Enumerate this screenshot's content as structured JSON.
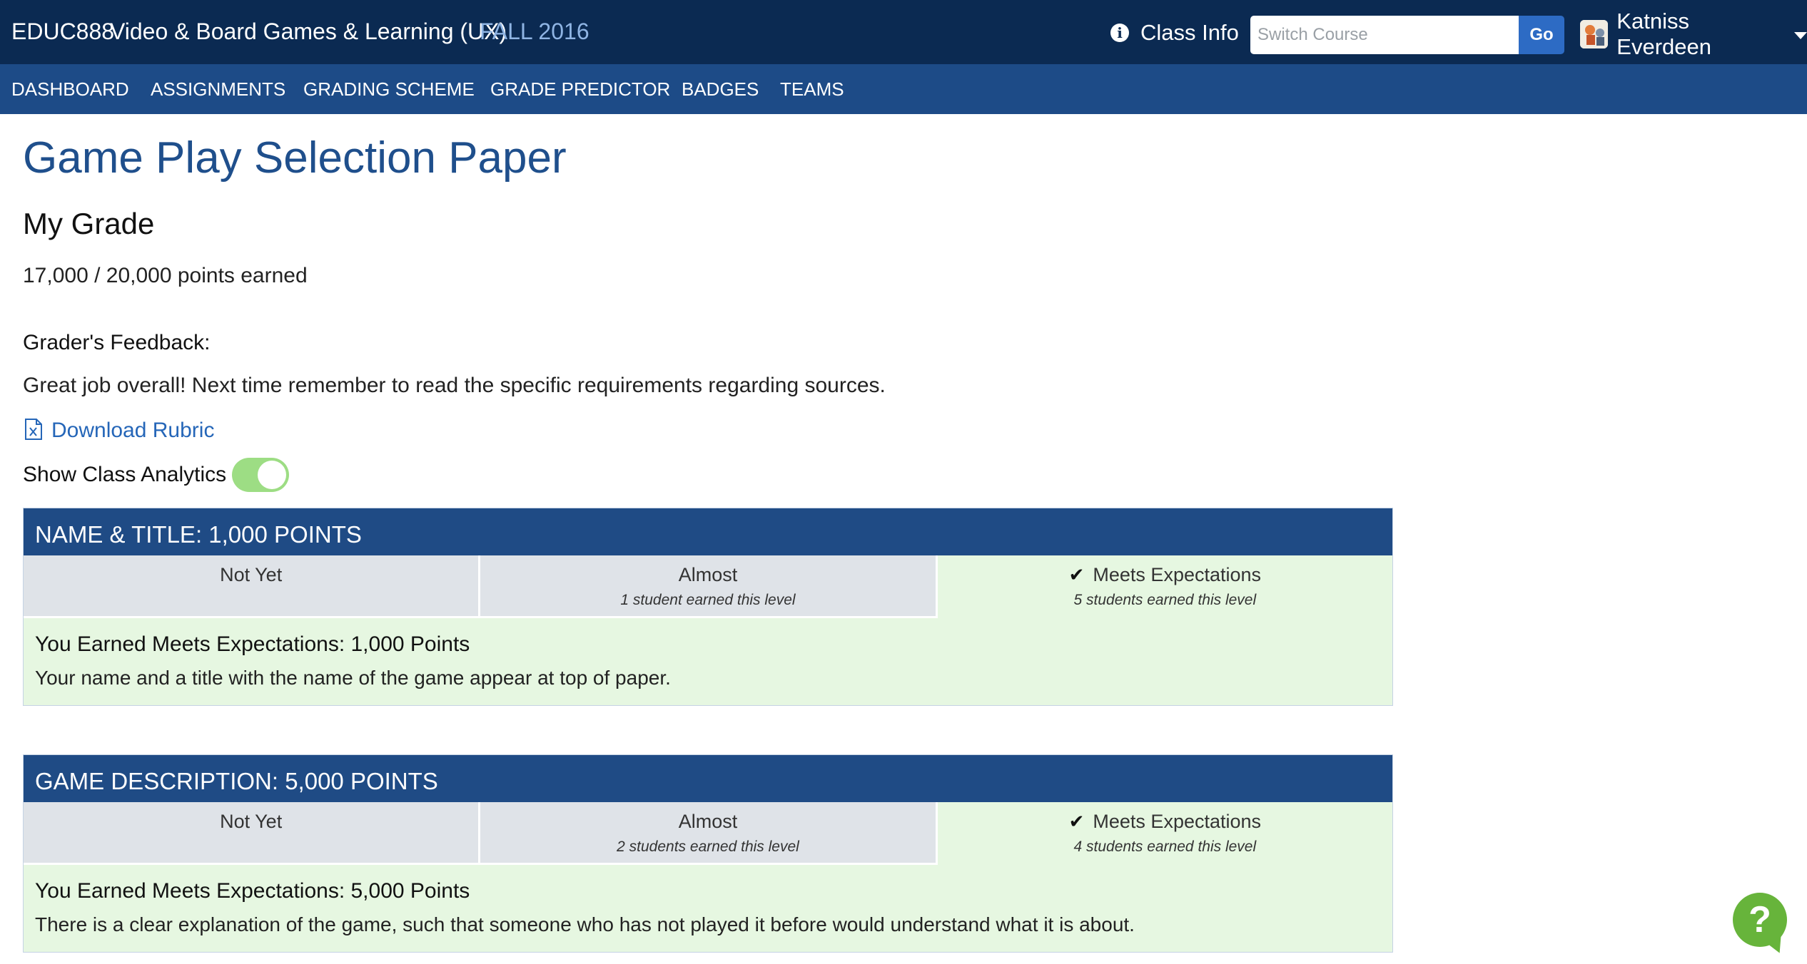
{
  "header": {
    "course_code": "EDUC888",
    "course_name": "Video & Board Games & Learning (UX)",
    "term": "FALL 2016",
    "class_info_label": "Class Info",
    "switch_course_placeholder": "Switch Course",
    "switch_course_value": "",
    "go_label": "Go",
    "user_name": "Katniss Everdeen"
  },
  "nav": {
    "items": [
      {
        "label": "DASHBOARD"
      },
      {
        "label": "ASSIGNMENTS"
      },
      {
        "label": "GRADING SCHEME"
      },
      {
        "label": "GRADE PREDICTOR"
      },
      {
        "label": "BADGES"
      },
      {
        "label": "TEAMS"
      }
    ]
  },
  "main": {
    "title": "Game Play Selection Paper",
    "grade_heading": "My Grade",
    "points_earned": "17,000 / 20,000 points earned",
    "feedback_label": "Grader's Feedback:",
    "feedback_text": "Great job overall! Next time remember to read the specific requirements regarding sources.",
    "download_label": "Download Rubric",
    "analytics_label": "Show Class Analytics",
    "analytics_enabled": true
  },
  "criteria": [
    {
      "header": "NAME & TITLE: 1,000 POINTS",
      "levels": [
        {
          "name": "Not Yet",
          "count": ""
        },
        {
          "name": "Almost",
          "count": "1 student earned this level"
        },
        {
          "name": "Meets Expectations",
          "count": "5 students earned this level",
          "selected": true
        }
      ],
      "earned_title": "You Earned Meets Expectations: 1,000 Points",
      "earned_desc": "Your name and a title with the name of the game appear at top of paper."
    },
    {
      "header": "GAME DESCRIPTION: 5,000 POINTS",
      "levels": [
        {
          "name": "Not Yet",
          "count": ""
        },
        {
          "name": "Almost",
          "count": "2 students earned this level"
        },
        {
          "name": "Meets Expectations",
          "count": "4 students earned this level",
          "selected": true
        }
      ],
      "earned_title": "You Earned Meets Expectations: 5,000 Points",
      "earned_desc": "There is a clear explanation of the game, such that someone who has not played it before would understand what it is about."
    }
  ],
  "icons": {
    "info": "info-icon",
    "check": "check-icon",
    "excel_file": "excel-file-icon",
    "help": "help-icon",
    "caret": "caret-down-icon"
  },
  "colors": {
    "topbar": "#0b2a52",
    "navbar": "#1d4b87",
    "title": "#1f4f8c",
    "link": "#2566b8",
    "selected_level": "#e6f7e1",
    "toggle_on": "#9ddd84",
    "help": "#67b43b"
  }
}
